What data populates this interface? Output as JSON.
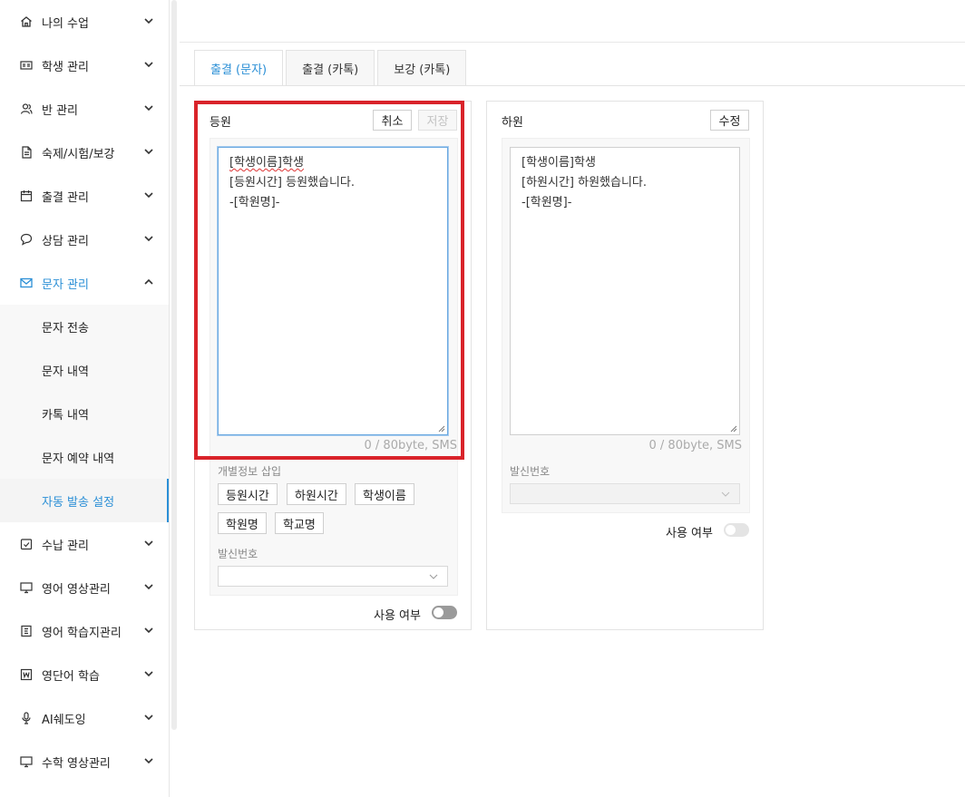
{
  "colors": {
    "accent": "#2b8fd6",
    "highlight": "#d9232a"
  },
  "sidebar": {
    "items": [
      {
        "label": "나의 수업",
        "icon": "home-icon"
      },
      {
        "label": "학생 관리",
        "icon": "id-card-icon"
      },
      {
        "label": "반 관리",
        "icon": "users-icon"
      },
      {
        "label": "숙제/시험/보강",
        "icon": "document-icon"
      },
      {
        "label": "출결 관리",
        "icon": "calendar-icon"
      },
      {
        "label": "상담 관리",
        "icon": "chat-icon"
      },
      {
        "label": "문자 관리",
        "icon": "mail-icon",
        "expanded": true
      },
      {
        "label": "수납 관리",
        "icon": "payment-check-icon"
      },
      {
        "label": "영어 영상관리",
        "icon": "monitor-icon"
      },
      {
        "label": "영어 학습지관리",
        "icon": "worksheet-icon"
      },
      {
        "label": "영단어 학습",
        "icon": "vocab-icon"
      },
      {
        "label": "AI쉐도잉",
        "icon": "microphone-icon"
      },
      {
        "label": "수학 영상관리",
        "icon": "monitor-icon"
      }
    ],
    "sub_items": [
      {
        "label": "문자 전송"
      },
      {
        "label": "문자 내역"
      },
      {
        "label": "카톡 내역"
      },
      {
        "label": "문자 예약 내역"
      },
      {
        "label": "자동 발송 설정",
        "selected": true
      }
    ]
  },
  "tabs": [
    {
      "label": "출결 (문자)",
      "active": true
    },
    {
      "label": "출결 (카톡)"
    },
    {
      "label": "보강 (카톡)"
    }
  ],
  "checkin_panel": {
    "title": "등원",
    "cancel_label": "취소",
    "save_label": "저장",
    "lines": [
      "[학생이름]학생",
      "[등원시간] 등원했습니다.",
      "-[학원명]-"
    ],
    "counter": "0 / 80byte, SMS",
    "insert_label": "개별정보 삽입",
    "chips": [
      "등원시간",
      "하원시간",
      "학생이름",
      "학원명",
      "학교명"
    ],
    "sender_label": "발신번호",
    "sender_value": "",
    "use_label": "사용 여부",
    "use_enabled": false
  },
  "checkout_panel": {
    "title": "하원",
    "edit_label": "수정",
    "lines": [
      "[학생이름]학생",
      "[하원시간] 하원했습니다.",
      "-[학원명]-"
    ],
    "counter": "0 / 80byte, SMS",
    "sender_label": "발신번호",
    "sender_value": "",
    "use_label": "사용 여부",
    "use_enabled": false
  }
}
